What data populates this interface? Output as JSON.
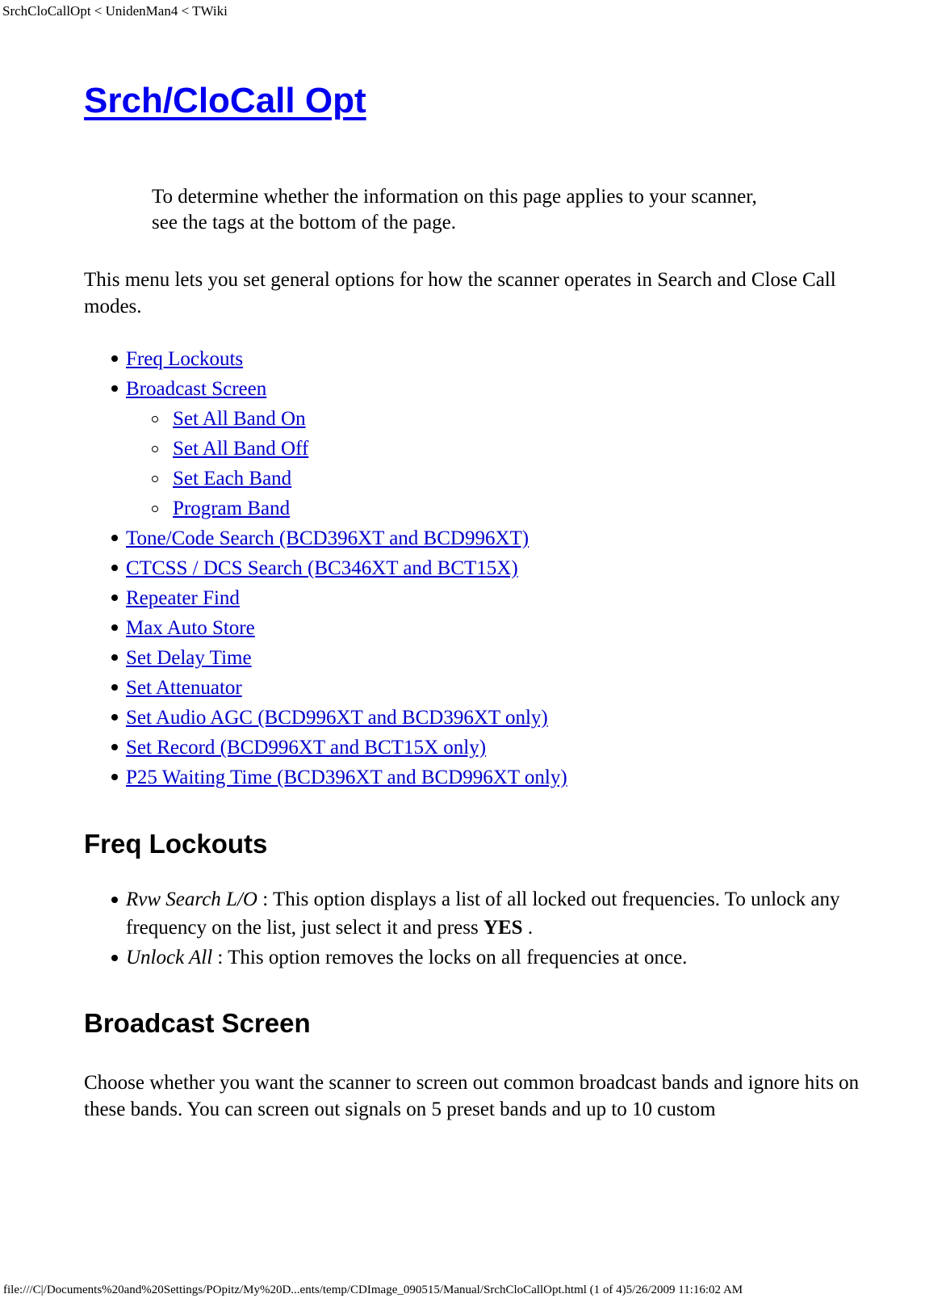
{
  "browser": {
    "print_header": "SrchCloCallOpt < UnidenMan4 < TWiki"
  },
  "document": {
    "title": "Srch/CloCall Opt",
    "note": "To determine whether the information on this page applies to your scanner, see the tags at the bottom of the page.",
    "intro": "This menu lets you set general options for how the scanner operates in Search and Close Call modes.",
    "toc": [
      {
        "label": "Freq Lockouts",
        "children": []
      },
      {
        "label": "Broadcast Screen",
        "children": [
          {
            "label": "Set All Band On"
          },
          {
            "label": "Set All Band Off"
          },
          {
            "label": "Set Each Band"
          },
          {
            "label": "Program Band"
          }
        ]
      },
      {
        "label": "Tone/Code Search (BCD396XT and BCD996XT)",
        "children": []
      },
      {
        "label": "CTCSS / DCS Search (BC346XT and BCT15X)",
        "children": []
      },
      {
        "label": "Repeater Find",
        "children": []
      },
      {
        "label": "Max Auto Store",
        "children": []
      },
      {
        "label": "Set Delay Time",
        "children": []
      },
      {
        "label": "Set Attenuator",
        "children": []
      },
      {
        "label": "Set Audio AGC (BCD996XT and BCD396XT only)",
        "children": []
      },
      {
        "label": "Set Record (BCD996XT and BCT15X only)",
        "children": []
      },
      {
        "label": "P25 Waiting Time (BCD396XT and BCD996XT only)",
        "children": []
      }
    ],
    "sections": [
      {
        "heading": "Freq Lockouts",
        "definitions": [
          {
            "term": "Rvw Search L/O",
            "sep": " : ",
            "text_before_kbd": "This option displays a list of all locked out frequencies. To unlock any frequency on the list, just select it and press ",
            "kbd": "YES",
            "text_after_kbd": " ."
          },
          {
            "term": "Unlock All",
            "sep": " : ",
            "text_before_kbd": "This option removes the locks on all frequencies at once.",
            "kbd": "",
            "text_after_kbd": ""
          }
        ]
      },
      {
        "heading": "Broadcast Screen",
        "paragraph": "Choose whether you want the scanner to screen out common broadcast bands and ignore hits on these bands. You can screen out signals on 5 preset bands and up to 10 custom"
      }
    ]
  },
  "footer": {
    "text": "file:///C|/Documents%20and%20Settings/POpitz/My%20D...ents/temp/CDImage_090515/Manual/SrchCloCallOpt.html (1 of 4)5/26/2009 11:16:02 AM"
  },
  "colors": {
    "link": "#0000cc",
    "text": "#000000",
    "background": "#ffffff"
  }
}
